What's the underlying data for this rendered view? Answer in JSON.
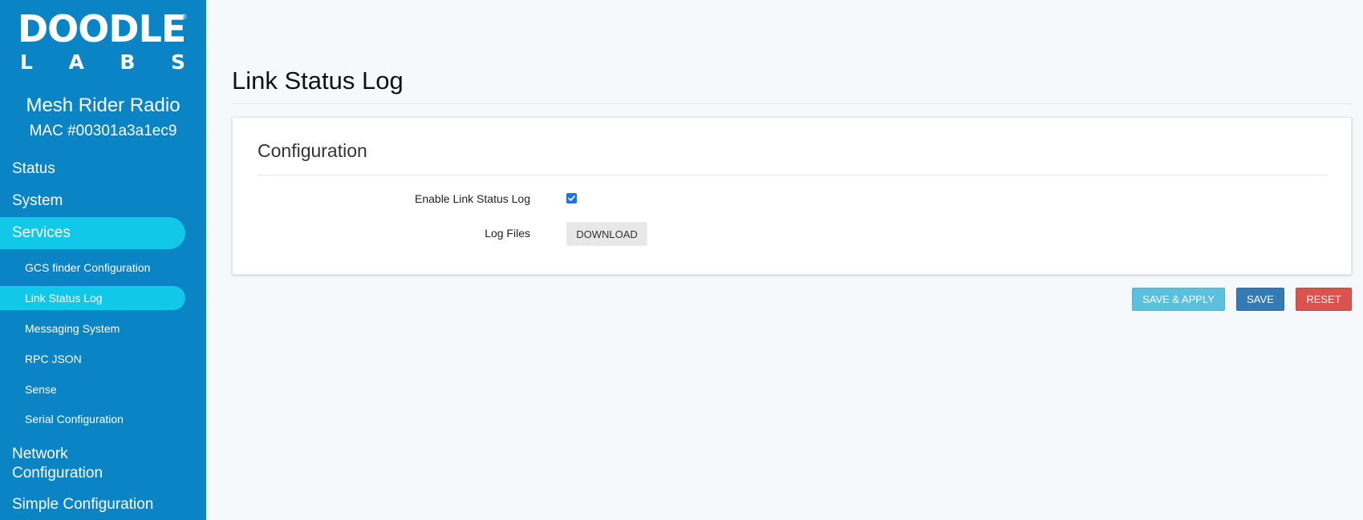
{
  "brand": {
    "logo_main": "DOODLE",
    "logo_reg": "®",
    "logo_sub_letters": [
      "L",
      "A",
      "B",
      "S"
    ]
  },
  "device": {
    "name": "Mesh Rider Radio",
    "mac": "MAC #00301a3a1ec9"
  },
  "nav": {
    "status": "Status",
    "system": "System",
    "services": "Services",
    "services_sub": [
      "GCS finder Configuration",
      "Link Status Log",
      "Messaging System",
      "RPC JSON",
      "Sense",
      "Serial Configuration"
    ],
    "network_line1": "Network",
    "network_line2": "Configuration",
    "simple_configuration": "Simple Configuration"
  },
  "page": {
    "title": "Link Status Log"
  },
  "section": {
    "title": "Configuration",
    "enable_label": "Enable Link Status Log",
    "enable_checked": true,
    "log_files_label": "Log Files",
    "download_label": "DOWNLOAD"
  },
  "actions": {
    "save_apply": "SAVE & APPLY",
    "save": "SAVE",
    "reset": "RESET"
  },
  "colors": {
    "sidebar": "#0b84c6",
    "active": "#12c8e8",
    "save_apply": "#5bc0de",
    "save": "#337ab7",
    "reset": "#d9534f"
  }
}
